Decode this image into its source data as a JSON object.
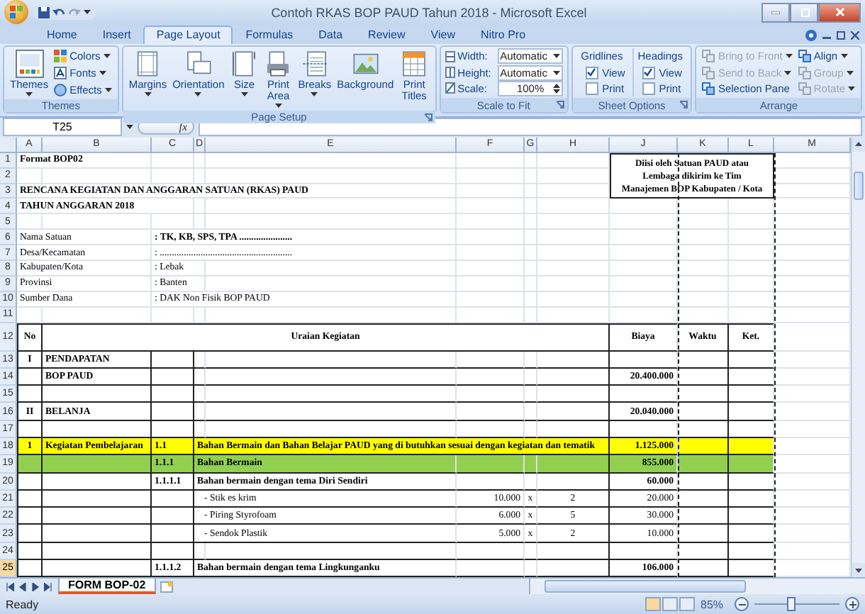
{
  "title_bar": {
    "title": "Contoh RKAS BOP PAUD Tahun 2018 - Microsoft Excel"
  },
  "tabs": [
    {
      "label": "Home",
      "selected": false
    },
    {
      "label": "Insert",
      "selected": false
    },
    {
      "label": "Page Layout",
      "selected": true
    },
    {
      "label": "Formulas",
      "selected": false
    },
    {
      "label": "Data",
      "selected": false
    },
    {
      "label": "Review",
      "selected": false
    },
    {
      "label": "View",
      "selected": false
    },
    {
      "label": "Nitro Pro",
      "selected": false
    }
  ],
  "ribbon": {
    "groups": [
      {
        "kind": "themes",
        "label": "Themes",
        "launcher": false,
        "large": [
          {
            "label": "Themes",
            "dropdown": true
          }
        ],
        "small": [
          {
            "label": "Colors",
            "dropdown": true
          },
          {
            "label": "Fonts",
            "dropdown": true
          },
          {
            "label": "Effects",
            "dropdown": true
          }
        ]
      },
      {
        "kind": "page_setup",
        "label": "Page Setup",
        "launcher": true,
        "large": [
          {
            "label": "Margins",
            "dropdown": true
          },
          {
            "label": "Orientation",
            "dropdown": true
          },
          {
            "label": "Size",
            "dropdown": true
          },
          {
            "label": "Print Area",
            "dropdown": true
          },
          {
            "label": "Breaks",
            "dropdown": true
          },
          {
            "label": "Background",
            "dropdown": false
          },
          {
            "label": "Print Titles",
            "dropdown": false
          }
        ]
      },
      {
        "kind": "scale",
        "label": "Scale to Fit",
        "launcher": true,
        "fields": [
          {
            "label": "Width:",
            "value": "Automatic",
            "kind": "dropdown"
          },
          {
            "label": "Height:",
            "value": "Automatic",
            "kind": "dropdown"
          },
          {
            "label": "Scale:",
            "value": "100%",
            "kind": "spinner"
          }
        ]
      },
      {
        "kind": "sheet_options",
        "label": "Sheet Options",
        "launcher": true,
        "columns": [
          {
            "heading": "Gridlines",
            "options": [
              {
                "label": "View",
                "checked": true
              },
              {
                "label": "Print",
                "checked": false
              }
            ]
          },
          {
            "heading": "Headings",
            "options": [
              {
                "label": "View",
                "checked": true
              },
              {
                "label": "Print",
                "checked": false
              }
            ]
          }
        ]
      },
      {
        "kind": "arrange",
        "label": "Arrange",
        "launcher": false,
        "columns": [
          [
            {
              "label": "Bring to Front",
              "disabled": true,
              "dropdown": true
            },
            {
              "label": "Send to Back",
              "disabled": true,
              "dropdown": true
            },
            {
              "label": "Selection Pane",
              "disabled": false,
              "dropdown": false
            }
          ],
          [
            {
              "label": "Align",
              "disabled": false,
              "dropdown": true
            },
            {
              "label": "Group",
              "disabled": true,
              "dropdown": true
            },
            {
              "label": "Rotate",
              "disabled": true,
              "dropdown": true
            }
          ]
        ]
      }
    ]
  },
  "formula_bar": {
    "name_box": "T25",
    "function_label": "fx"
  },
  "sheet": {
    "columns": [
      "A",
      "B",
      "C",
      "D",
      "E",
      "F",
      "G",
      "H",
      "J",
      "K",
      "L",
      "M"
    ],
    "rows": [
      {
        "n": "1",
        "kind": "plain",
        "selected": false,
        "cells": [
          {
            "text": "Format BOP02",
            "kind": "text",
            "bold": true
          },
          {
            "kind": "merged"
          },
          null,
          null,
          null,
          null,
          null,
          null,
          {
            "text": "Diisi oleh Satuan PAUD atau Lembaga dikirim ke Tim Manajemen BOP Kabupaten / Kota",
            "kind": "box",
            "bold": true
          },
          {
            "kind": "merged"
          },
          {
            "kind": "merged"
          }
        ]
      },
      {
        "n": "2",
        "kind": "plain",
        "selected": false,
        "cells": [
          null,
          null,
          null,
          null,
          null,
          null,
          null,
          null,
          {
            "kind": "merged"
          },
          {
            "kind": "merged"
          },
          {
            "kind": "merged"
          }
        ]
      },
      {
        "n": "3",
        "kind": "plain",
        "selected": false,
        "cells": [
          {
            "text": "RENCANA KEGIATAN DAN ANGGARAN SATUAN (RKAS) PAUD",
            "kind": "text",
            "bold": true
          },
          {
            "kind": "merged"
          },
          {
            "kind": "merged"
          },
          {
            "kind": "merged"
          },
          {
            "kind": "merged"
          },
          null,
          null,
          null,
          {
            "kind": "merged"
          },
          {
            "kind": "merged"
          },
          {
            "kind": "merged"
          }
        ]
      },
      {
        "n": "4",
        "kind": "plain",
        "selected": false,
        "cells": [
          {
            "text": "TAHUN ANGGARAN 2018",
            "kind": "text",
            "bold": true
          },
          {
            "kind": "merged"
          },
          {
            "kind": "merged"
          }
        ]
      },
      {
        "n": "5",
        "kind": "plain",
        "selected": false
      },
      {
        "n": "6",
        "kind": "plain",
        "selected": false,
        "cells": [
          {
            "text": "Nama Satuan",
            "kind": "text",
            "bold": false
          },
          {
            "kind": "merged"
          },
          {
            "text": ": TK, KB, SPS, TPA ......................",
            "kind": "text",
            "bold": true
          },
          {
            "kind": "merged"
          },
          {
            "kind": "merged"
          }
        ]
      },
      {
        "n": "7",
        "kind": "plain",
        "selected": false,
        "cells": [
          {
            "text": "Desa/Kecamatan",
            "kind": "text",
            "bold": false
          },
          {
            "kind": "merged"
          },
          {
            "text": ": .......................................................",
            "kind": "text",
            "bold": false
          },
          {
            "kind": "merged"
          },
          {
            "kind": "merged"
          }
        ]
      },
      {
        "n": "8",
        "kind": "plain",
        "selected": false,
        "cells": [
          {
            "text": "Kabupaten/Kota",
            "kind": "text",
            "bold": false
          },
          {
            "kind": "merged"
          },
          {
            "text": ": Lebak",
            "kind": "text",
            "bold": false
          },
          {
            "kind": "merged"
          }
        ]
      },
      {
        "n": "9",
        "kind": "plain",
        "selected": false,
        "cells": [
          {
            "text": "Provinsi",
            "kind": "text",
            "bold": false
          },
          {
            "kind": "merged"
          },
          {
            "text": ": Banten",
            "kind": "text",
            "bold": false
          },
          {
            "kind": "merged"
          }
        ]
      },
      {
        "n": "10",
        "kind": "plain",
        "selected": false,
        "cells": [
          {
            "text": "Sumber Dana",
            "kind": "text",
            "bold": false
          },
          {
            "kind": "merged"
          },
          {
            "text": ": DAK Non Fisik BOP PAUD",
            "kind": "text",
            "bold": false
          },
          {
            "kind": "merged"
          },
          {
            "kind": "merged"
          }
        ]
      },
      {
        "n": "11",
        "kind": "plain",
        "selected": false
      },
      {
        "n": "12",
        "kind": "table_head",
        "selected": false,
        "cells": [
          {
            "text": "No",
            "kind": "center",
            "bold": true
          },
          {
            "text": "Uraian Kegiatan",
            "kind": "center",
            "bold": true
          },
          {
            "kind": "merged"
          },
          {
            "kind": "merged"
          },
          {
            "kind": "merged"
          },
          {
            "kind": "merged"
          },
          {
            "kind": "merged"
          },
          {
            "kind": "merged"
          },
          {
            "text": "Biaya",
            "kind": "center",
            "bold": true
          },
          {
            "text": "Waktu",
            "kind": "center",
            "bold": true
          },
          {
            "text": "Ket.",
            "kind": "center",
            "bold": true
          }
        ]
      },
      {
        "n": "13",
        "kind": "table",
        "selected": false,
        "cells": [
          {
            "text": "I",
            "kind": "center",
            "bold": true
          },
          {
            "text": "PENDAPATAN",
            "kind": "text",
            "bold": true
          }
        ]
      },
      {
        "n": "14",
        "kind": "table",
        "selected": false,
        "cells": [
          null,
          {
            "text": "BOP PAUD",
            "kind": "text",
            "bold": true
          },
          null,
          null,
          null,
          null,
          null,
          null,
          {
            "text": "20.400.000",
            "kind": "number",
            "bold": true
          }
        ]
      },
      {
        "n": "15",
        "kind": "table",
        "selected": false
      },
      {
        "n": "16",
        "kind": "table",
        "selected": false,
        "cells": [
          {
            "text": "II",
            "kind": "center",
            "bold": true
          },
          {
            "text": "BELANJA",
            "kind": "text",
            "bold": true
          },
          null,
          null,
          null,
          null,
          null,
          null,
          {
            "text": "20.040.000",
            "kind": "number",
            "bold": true
          }
        ]
      },
      {
        "n": "17",
        "kind": "table",
        "selected": false
      },
      {
        "n": "18",
        "kind": "table",
        "selected": false,
        "color": "#ffff00",
        "cells": [
          {
            "text": "1",
            "kind": "center",
            "bold": true
          },
          {
            "text": "Kegiatan Pembelajaran",
            "kind": "text",
            "bold": true
          },
          {
            "text": "1.1",
            "kind": "text",
            "bold": true
          },
          {
            "text": "Bahan Bermain dan Bahan Belajar PAUD yang di butuhkan sesuai dengan kegiatan dan tematik",
            "kind": "text",
            "bold": true
          },
          {
            "kind": "merged"
          },
          {
            "kind": "merged"
          },
          {
            "kind": "merged"
          },
          {
            "kind": "merged"
          },
          {
            "text": "1.125.000",
            "kind": "number",
            "bold": true
          }
        ]
      },
      {
        "n": "19",
        "kind": "table",
        "selected": false,
        "color": "#92d050",
        "cells": [
          null,
          null,
          {
            "text": "1.1.1",
            "kind": "text",
            "bold": true
          },
          {
            "text": "Bahan Bermain",
            "kind": "text",
            "bold": true
          },
          {
            "kind": "merged"
          },
          null,
          null,
          null,
          {
            "text": "855.000",
            "kind": "number",
            "bold": true
          }
        ]
      },
      {
        "n": "20",
        "kind": "table",
        "selected": false,
        "cells": [
          null,
          null,
          {
            "text": "1.1.1.1",
            "kind": "text",
            "bold": true
          },
          {
            "text": "Bahan bermain dengan tema Diri Sendiri",
            "kind": "text",
            "bold": true
          },
          {
            "kind": "merged"
          },
          null,
          null,
          null,
          {
            "text": "60.000",
            "kind": "number",
            "bold": true
          }
        ]
      },
      {
        "n": "21",
        "kind": "table",
        "selected": false,
        "cells": [
          null,
          null,
          null,
          {
            "text": "- Stik es krim",
            "kind": "item",
            "bold": false
          },
          {
            "kind": "merged"
          },
          {
            "text": "10.000",
            "kind": "number",
            "bold": false
          },
          {
            "text": "x",
            "kind": "center",
            "bold": false
          },
          {
            "text": "2",
            "kind": "center",
            "bold": false
          },
          {
            "text": "20.000",
            "kind": "number",
            "bold": false
          }
        ]
      },
      {
        "n": "22",
        "kind": "table",
        "selected": false,
        "cells": [
          null,
          null,
          null,
          {
            "text": "- Piring Styrofoam",
            "kind": "item",
            "bold": false
          },
          {
            "kind": "merged"
          },
          {
            "text": "6.000",
            "kind": "number",
            "bold": false
          },
          {
            "text": "x",
            "kind": "center",
            "bold": false
          },
          {
            "text": "5",
            "kind": "center",
            "bold": false
          },
          {
            "text": "30.000",
            "kind": "number",
            "bold": false
          }
        ]
      },
      {
        "n": "23",
        "kind": "table",
        "selected": false,
        "cells": [
          null,
          null,
          null,
          {
            "text": "- Sendok Plastik",
            "kind": "item",
            "bold": false
          },
          {
            "kind": "merged"
          },
          {
            "text": "5.000",
            "kind": "number",
            "bold": false
          },
          {
            "text": "x",
            "kind": "center",
            "bold": false
          },
          {
            "text": "2",
            "kind": "center",
            "bold": false
          },
          {
            "text": "10.000",
            "kind": "number",
            "bold": false
          }
        ]
      },
      {
        "n": "24",
        "kind": "table",
        "selected": false
      },
      {
        "n": "25",
        "kind": "table",
        "selected": true,
        "cells": [
          null,
          null,
          {
            "text": "1.1.1.2",
            "kind": "text",
            "bold": true
          },
          {
            "text": "Bahan bermain dengan tema Lingkunganku",
            "kind": "text",
            "bold": true
          },
          {
            "kind": "merged"
          },
          null,
          null,
          null,
          {
            "text": "106.000",
            "kind": "number",
            "bold": true
          }
        ]
      }
    ]
  },
  "sheet_tabs": [
    {
      "label": "FORM BOP-02",
      "selected": true
    }
  ],
  "status_bar": {
    "status": "Ready",
    "zoom": "85%",
    "zoom_level": {
      "level": 0.42
    }
  }
}
